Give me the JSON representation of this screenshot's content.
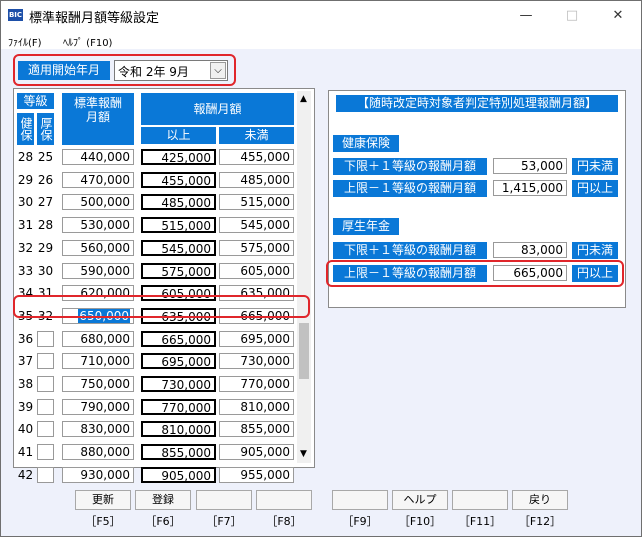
{
  "window": {
    "title": "標準報酬月額等級設定",
    "app_icon": "BIC",
    "minimize": "—",
    "maximize": "□",
    "close": "✕"
  },
  "menu": {
    "file": "ﾌｧｲﾙ(F)",
    "help": "ﾍﾙﾌﾟ (F10)"
  },
  "start": {
    "label": "適用開始年月",
    "value": "令和 2年 9月",
    "dropdown_glyph": "⌵"
  },
  "table": {
    "header_grade": "等級",
    "header_kenpo": "健保",
    "header_kosei": "厚保",
    "header_standard": "標準報酬月額",
    "header_range": "報酬月額",
    "header_min": "以上",
    "header_max": "未満",
    "rows": [
      {
        "k": "28",
        "s": "25",
        "std": "440,000",
        "min": "425,000",
        "max": "455,000"
      },
      {
        "k": "29",
        "s": "26",
        "std": "470,000",
        "min": "455,000",
        "max": "485,000"
      },
      {
        "k": "30",
        "s": "27",
        "std": "500,000",
        "min": "485,000",
        "max": "515,000"
      },
      {
        "k": "31",
        "s": "28",
        "std": "530,000",
        "min": "515,000",
        "max": "545,000"
      },
      {
        "k": "32",
        "s": "29",
        "std": "560,000",
        "min": "545,000",
        "max": "575,000"
      },
      {
        "k": "33",
        "s": "30",
        "std": "590,000",
        "min": "575,000",
        "max": "605,000"
      },
      {
        "k": "34",
        "s": "31",
        "std": "620,000",
        "min": "605,000",
        "max": "635,000"
      },
      {
        "k": "35",
        "s": "32",
        "std": "650,000",
        "min": "635,000",
        "max": "665,000"
      },
      {
        "k": "36",
        "s": "",
        "std": "680,000",
        "min": "665,000",
        "max": "695,000"
      },
      {
        "k": "37",
        "s": "",
        "std": "710,000",
        "min": "695,000",
        "max": "730,000"
      },
      {
        "k": "38",
        "s": "",
        "std": "750,000",
        "min": "730,000",
        "max": "770,000"
      },
      {
        "k": "39",
        "s": "",
        "std": "790,000",
        "min": "770,000",
        "max": "810,000"
      },
      {
        "k": "40",
        "s": "",
        "std": "830,000",
        "min": "810,000",
        "max": "855,000"
      },
      {
        "k": "41",
        "s": "",
        "std": "880,000",
        "min": "855,000",
        "max": "905,000"
      },
      {
        "k": "42",
        "s": "",
        "std": "930,000",
        "min": "905,000",
        "max": "955,000"
      }
    ]
  },
  "special": {
    "title": "【随時改定時対象者判定特別処理報酬月額】",
    "kenko_title": "健康保険",
    "kenko_lower_label": "下限＋１等級の報酬月額",
    "kenko_lower_value": "53,000",
    "kenko_lower_unit": "円未満",
    "kenko_upper_label": "上限－１等級の報酬月額",
    "kenko_upper_value": "1,415,000",
    "kenko_upper_unit": "円以上",
    "kosei_title": "厚生年金",
    "kosei_lower_label": "下限＋１等級の報酬月額",
    "kosei_lower_value": "83,000",
    "kosei_lower_unit": "円未満",
    "kosei_upper_label": "上限－１等級の報酬月額",
    "kosei_upper_value": "665,000",
    "kosei_upper_unit": "円以上"
  },
  "fkeys": [
    {
      "label": "更新",
      "key": "［F5］"
    },
    {
      "label": "登録",
      "key": "［F6］"
    },
    {
      "label": "",
      "key": "［F7］"
    },
    {
      "label": "",
      "key": "［F8］"
    },
    {
      "label": "",
      "key": "［F9］"
    },
    {
      "label": "ヘルプ",
      "key": "［F10］"
    },
    {
      "label": "",
      "key": "［F11］"
    },
    {
      "label": "戻り",
      "key": "［F12］"
    }
  ],
  "colors": {
    "header_blue": "#0a78d7",
    "highlight": "#e0262b",
    "selected_bg": "#0a78d7"
  }
}
